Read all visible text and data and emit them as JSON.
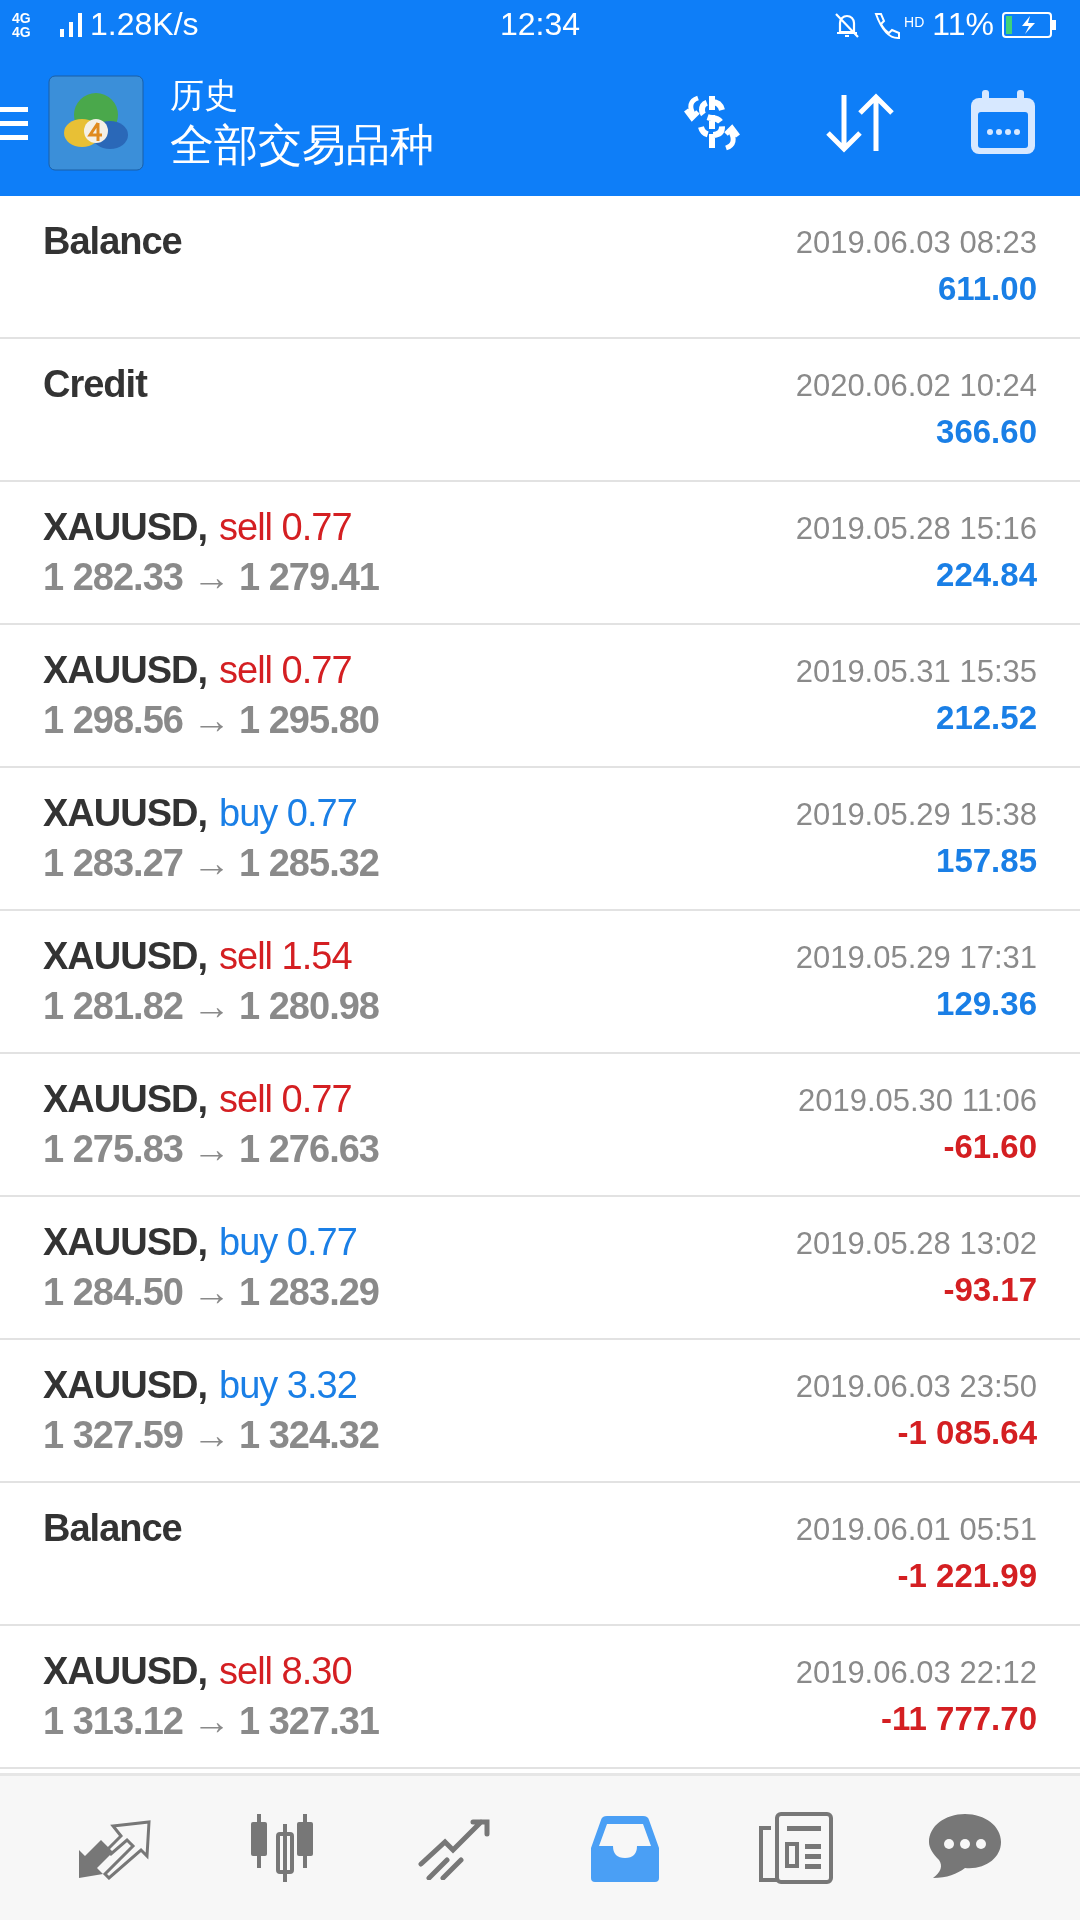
{
  "status_bar": {
    "network": "4G 4G",
    "speed": "1.28K/s",
    "time": "12:34",
    "call_label": "HD",
    "battery": "11%"
  },
  "header": {
    "title": "历史",
    "subtitle": "全部交易品种"
  },
  "history": [
    {
      "kind": "balance",
      "label": "Balance",
      "time": "2019.06.03 08:23",
      "amount": "611.00",
      "positive": true
    },
    {
      "kind": "balance",
      "label": "Credit",
      "time": "2020.06.02 10:24",
      "amount": "366.60",
      "positive": true
    },
    {
      "kind": "trade",
      "symbol": "XAUUSD,",
      "direction": "sell",
      "volume": "0.77",
      "prices": "1 282.33 → 1 279.41",
      "time": "2019.05.28 15:16",
      "amount": "224.84",
      "positive": true
    },
    {
      "kind": "trade",
      "symbol": "XAUUSD,",
      "direction": "sell",
      "volume": "0.77",
      "prices": "1 298.56 → 1 295.80",
      "time": "2019.05.31 15:35",
      "amount": "212.52",
      "positive": true
    },
    {
      "kind": "trade",
      "symbol": "XAUUSD,",
      "direction": "buy",
      "volume": "0.77",
      "prices": "1 283.27 → 1 285.32",
      "time": "2019.05.29 15:38",
      "amount": "157.85",
      "positive": true
    },
    {
      "kind": "trade",
      "symbol": "XAUUSD,",
      "direction": "sell",
      "volume": "1.54",
      "prices": "1 281.82 → 1 280.98",
      "time": "2019.05.29 17:31",
      "amount": "129.36",
      "positive": true
    },
    {
      "kind": "trade",
      "symbol": "XAUUSD,",
      "direction": "sell",
      "volume": "0.77",
      "prices": "1 275.83 → 1 276.63",
      "time": "2019.05.30 11:06",
      "amount": "-61.60",
      "positive": false
    },
    {
      "kind": "trade",
      "symbol": "XAUUSD,",
      "direction": "buy",
      "volume": "0.77",
      "prices": "1 284.50 → 1 283.29",
      "time": "2019.05.28 13:02",
      "amount": "-93.17",
      "positive": false
    },
    {
      "kind": "trade",
      "symbol": "XAUUSD,",
      "direction": "buy",
      "volume": "3.32",
      "prices": "1 327.59 → 1 324.32",
      "time": "2019.06.03 23:50",
      "amount": "-1 085.64",
      "positive": false
    },
    {
      "kind": "balance",
      "label": "Balance",
      "time": "2019.06.01 05:51",
      "amount": "-1 221.99",
      "positive": false
    },
    {
      "kind": "trade",
      "symbol": "XAUUSD,",
      "direction": "sell",
      "volume": "8.30",
      "prices": "1 313.12 → 1 327.31",
      "time": "2019.06.03 22:12",
      "amount": "-11 777.70",
      "positive": false
    }
  ],
  "nav": [
    {
      "kind": "quotes",
      "selected": false
    },
    {
      "kind": "chart",
      "selected": false
    },
    {
      "kind": "trade",
      "selected": false
    },
    {
      "kind": "history",
      "selected": true
    },
    {
      "kind": "news",
      "selected": false
    },
    {
      "kind": "chat",
      "selected": false
    }
  ]
}
